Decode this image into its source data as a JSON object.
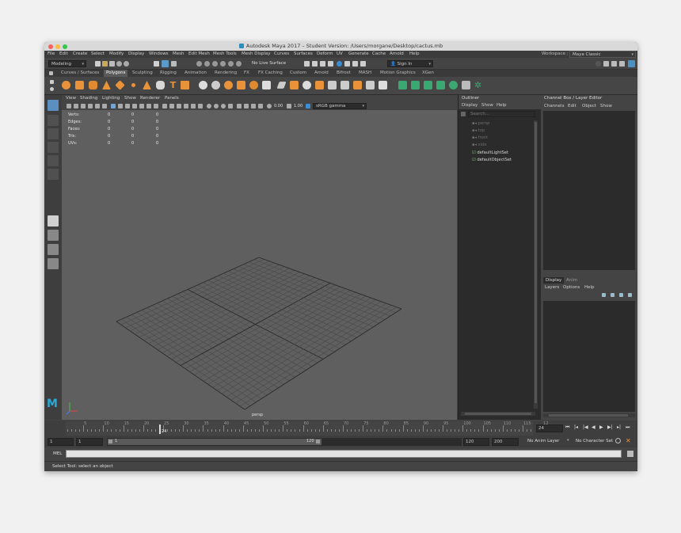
{
  "window": {
    "title": "Autodesk Maya 2017 – Student Version: /Users/morgane/Desktop/cactus.mb",
    "traffic_lights": [
      "#fc605c",
      "#fdbc40",
      "#34c84a"
    ]
  },
  "main_menu": [
    "File",
    "Edit",
    "Create",
    "Select",
    "Modify",
    "Display",
    "Windows",
    "Mesh",
    "Edit Mesh",
    "Mesh Tools",
    "Mesh Display",
    "Curves",
    "Surfaces",
    "Deform",
    "UV",
    "Generate",
    "Cache",
    "Arnold",
    "Help"
  ],
  "workspace": {
    "label": "Workspace :",
    "value": "Maya Classic"
  },
  "status_line": {
    "mode": "Modeling",
    "live_surface": "No Live Surface",
    "sign_in": "Sign In"
  },
  "shelf_tabs": [
    "Curves / Surfaces",
    "Polygons",
    "Sculpting",
    "Rigging",
    "Animation",
    "Rendering",
    "FX",
    "FX Caching",
    "Custom",
    "Arnold",
    "Bifrost",
    "MASH",
    "Motion Graphics",
    "XGen"
  ],
  "active_shelf": "Polygons",
  "viewport": {
    "menu": [
      "View",
      "Shading",
      "Lighting",
      "Show",
      "Renderer",
      "Panels"
    ],
    "exposure": "0.00",
    "gamma": "1.00",
    "color_space": "sRGB gamma",
    "hud": [
      {
        "label": "Verts:",
        "values": [
          "0",
          "0",
          "0"
        ]
      },
      {
        "label": "Edges:",
        "values": [
          "0",
          "0",
          "0"
        ]
      },
      {
        "label": "Faces:",
        "values": [
          "0",
          "0",
          "0"
        ]
      },
      {
        "label": "Tris:",
        "values": [
          "0",
          "0",
          "0"
        ]
      },
      {
        "label": "UVs:",
        "values": [
          "0",
          "0",
          "0"
        ]
      }
    ],
    "camera_label": "persp"
  },
  "outliner": {
    "title": "Outliner",
    "menu": [
      "Display",
      "Show",
      "Help"
    ],
    "search_placeholder": "Search...",
    "items": [
      "persp",
      "top",
      "front",
      "side",
      "defaultLightSet",
      "defaultObjectSet"
    ]
  },
  "channel_box": {
    "title": "Channel Box / Layer Editor",
    "menu": [
      "Channels",
      "Edit",
      "Object",
      "Show"
    ]
  },
  "layer_editor": {
    "tabs": [
      "Display",
      "Anim"
    ],
    "menu": [
      "Layers",
      "Options",
      "Help"
    ]
  },
  "time_slider": {
    "ticks": [
      "5",
      "10",
      "15",
      "20",
      "25",
      "30",
      "35",
      "40",
      "45",
      "50",
      "55",
      "60",
      "65",
      "70",
      "75",
      "80",
      "85",
      "90",
      "95",
      "100",
      "105",
      "110",
      "115",
      "12"
    ],
    "current_frame": "24",
    "current_marker": "24"
  },
  "range_slider": {
    "start": "1",
    "start_inner": "1",
    "range_start_label": "1",
    "range_end_label": "120",
    "end_inner": "120",
    "end": "200",
    "anim_layer": "No Anim Layer",
    "character_set": "No Character Set"
  },
  "command_line": {
    "lang": "MEL"
  },
  "help_line": "Select Tool: select an object"
}
